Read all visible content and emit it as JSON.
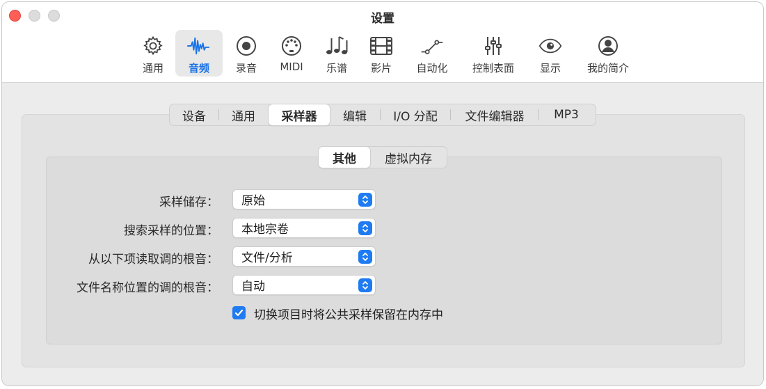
{
  "window": {
    "title": "设置"
  },
  "toolbar": [
    {
      "id": "general",
      "label": "通用",
      "icon": "gear-icon",
      "active": false
    },
    {
      "id": "audio",
      "label": "音频",
      "icon": "waveform-icon",
      "active": true
    },
    {
      "id": "record",
      "label": "录音",
      "icon": "record-icon",
      "active": false
    },
    {
      "id": "midi",
      "label": "MIDI",
      "icon": "midi-connector-icon",
      "active": false
    },
    {
      "id": "score",
      "label": "乐谱",
      "icon": "music-notes-icon",
      "active": false
    },
    {
      "id": "movie",
      "label": "影片",
      "icon": "film-icon",
      "active": false
    },
    {
      "id": "automation",
      "label": "自动化",
      "icon": "automation-curve-icon",
      "active": false
    },
    {
      "id": "control_surfaces",
      "label": "控制表面",
      "icon": "sliders-icon",
      "active": false
    },
    {
      "id": "display",
      "label": "显示",
      "icon": "eye-icon",
      "active": false
    },
    {
      "id": "my_info",
      "label": "我的简介",
      "icon": "person-circle-icon",
      "active": false
    }
  ],
  "tabs": [
    {
      "label": "设备",
      "selected": false
    },
    {
      "label": "通用",
      "selected": false
    },
    {
      "label": "采样器",
      "selected": true
    },
    {
      "label": "编辑",
      "selected": false
    },
    {
      "label": "I/O 分配",
      "selected": false
    },
    {
      "label": "文件编辑器",
      "selected": false
    },
    {
      "label": "MP3",
      "selected": false
    }
  ],
  "subtabs": [
    {
      "label": "其他",
      "selected": true
    },
    {
      "label": "虚拟内存",
      "selected": false
    }
  ],
  "settings": [
    {
      "label": "采样储存：",
      "value": "原始"
    },
    {
      "label": "搜索采样的位置：",
      "value": "本地宗卷"
    },
    {
      "label": "从以下项读取调的根音：",
      "value": "文件/分析"
    },
    {
      "label": "文件名称位置的调的根音：",
      "value": "自动"
    }
  ],
  "checkbox": {
    "label": "切换项目时将公共采样保留在内存中",
    "checked": true
  },
  "colors": {
    "accent": "#1f7bf2",
    "close": "#ff5f57"
  }
}
